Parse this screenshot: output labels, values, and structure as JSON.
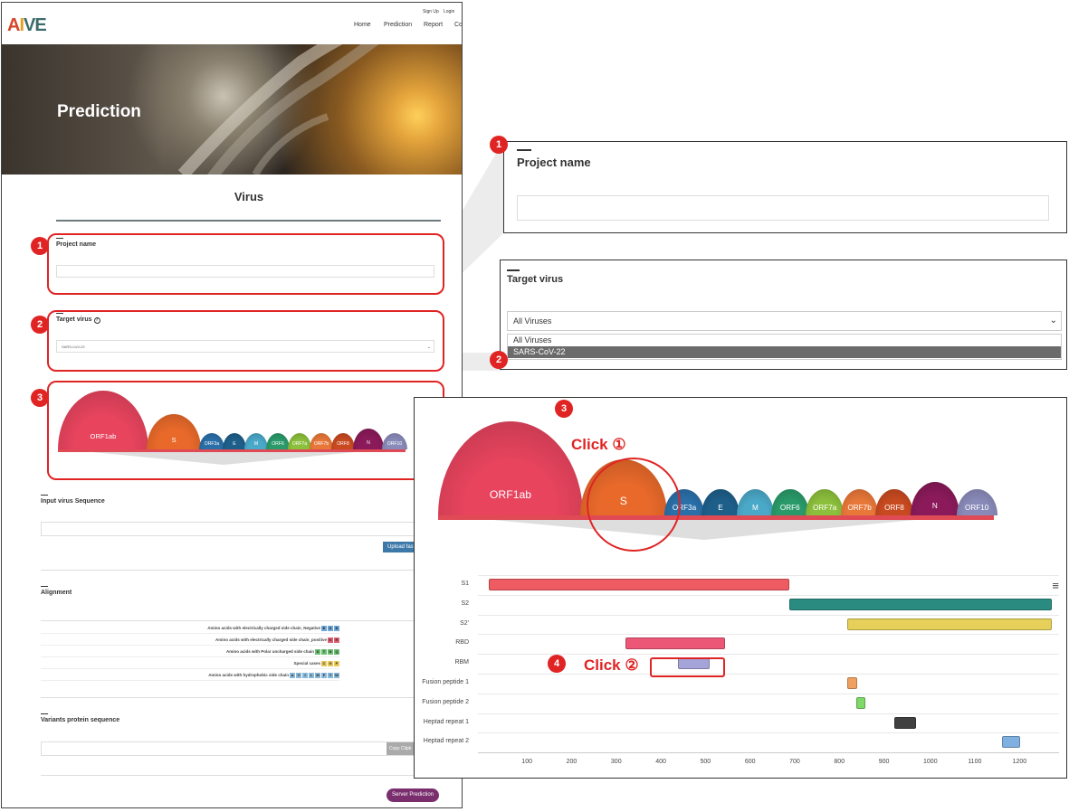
{
  "header": {
    "logo": "AIVE",
    "top_links": [
      "Sign Up",
      "Login"
    ],
    "nav": [
      "Home",
      "Prediction",
      "Report",
      "Co"
    ]
  },
  "hero": {
    "title": "Prediction"
  },
  "form": {
    "section_title": "Virus",
    "project_name_label": "Project name",
    "target_virus_label": "Target virus",
    "target_virus_value": "SARS-CoV-22",
    "input_sequence_label": "Input virus Sequence",
    "upload_button": "Upload fast",
    "alignment_label": "Alignment",
    "legend": [
      {
        "text": "Amino acids with electrically charged side chain_Negative",
        "chips": [
          "E",
          "D",
          "B"
        ],
        "color": "#6fa7d8"
      },
      {
        "text": "Amino acids with electrically charged side chain_positive",
        "chips": [
          "K",
          "R"
        ],
        "color": "#e06070"
      },
      {
        "text": "Amino acids with Polar uncharged side chain",
        "chips": [
          "S",
          "T",
          "N",
          "Q"
        ],
        "color": "#6fbf73"
      },
      {
        "text": "Special cases",
        "chips": [
          "C",
          "G",
          "P"
        ],
        "color": "#e8c85a"
      },
      {
        "text": "Amino acids with hydrophobic side chain",
        "chips": [
          "A",
          "V",
          "I",
          "L",
          "M",
          "F",
          "Y",
          "W"
        ],
        "color": "#8ab8d8"
      }
    ],
    "variants_label": "Variants protein sequence",
    "copy_button": "Copy Clipb",
    "server_button": "Server Prediction"
  },
  "badges": [
    "1",
    "2",
    "3",
    "4"
  ],
  "zoom1": {
    "label": "Project name"
  },
  "zoom2": {
    "label": "Target virus",
    "selected": "All Viruses",
    "options": [
      "All Viruses",
      "SARS-CoV-22"
    ]
  },
  "genome": {
    "genes": [
      "ORF1ab",
      "S",
      "ORF3a",
      "E",
      "M",
      "ORF6",
      "ORF7a",
      "ORF7b",
      "ORF8",
      "N",
      "ORF10"
    ],
    "colors": [
      "#e8445e",
      "#e8692a",
      "#2a6fa8",
      "#1e5f8a",
      "#4aa8c8",
      "#2a9a6a",
      "#8cbf3c",
      "#e8783a",
      "#c84a20",
      "#8a1a5a",
      "#8a8aba"
    ]
  },
  "annotations": {
    "click1": "Click ①",
    "click2": "Click ②"
  },
  "menu_icon": "hamburger-menu-icon",
  "chart_data": {
    "type": "bar",
    "tracks": [
      {
        "name": "S1",
        "start": 13,
        "end": 685,
        "color": "#ef5b62"
      },
      {
        "name": "S2",
        "start": 686,
        "end": 1273,
        "color": "#2a8c80"
      },
      {
        "name": "S2'",
        "start": 816,
        "end": 1273,
        "color": "#e6d05a"
      },
      {
        "name": "RBD",
        "start": 319,
        "end": 541,
        "color": "#ec5777"
      },
      {
        "name": "RBM",
        "start": 437,
        "end": 508,
        "color": "#a4a4d8"
      },
      {
        "name": "Fusion peptide 1",
        "start": 816,
        "end": 837,
        "color": "#f0a060"
      },
      {
        "name": "Fusion peptide 2",
        "start": 835,
        "end": 855,
        "color": "#7ed86a"
      },
      {
        "name": "Heptad repeat 1",
        "start": 920,
        "end": 970,
        "color": "#404040"
      },
      {
        "name": "Heptad repeat 2",
        "start": 1163,
        "end": 1202,
        "color": "#80b0e0"
      }
    ],
    "x_ticks": [
      100,
      200,
      300,
      400,
      500,
      600,
      700,
      800,
      900,
      1000,
      1100,
      1200
    ],
    "xlim": [
      0,
      1290
    ]
  }
}
